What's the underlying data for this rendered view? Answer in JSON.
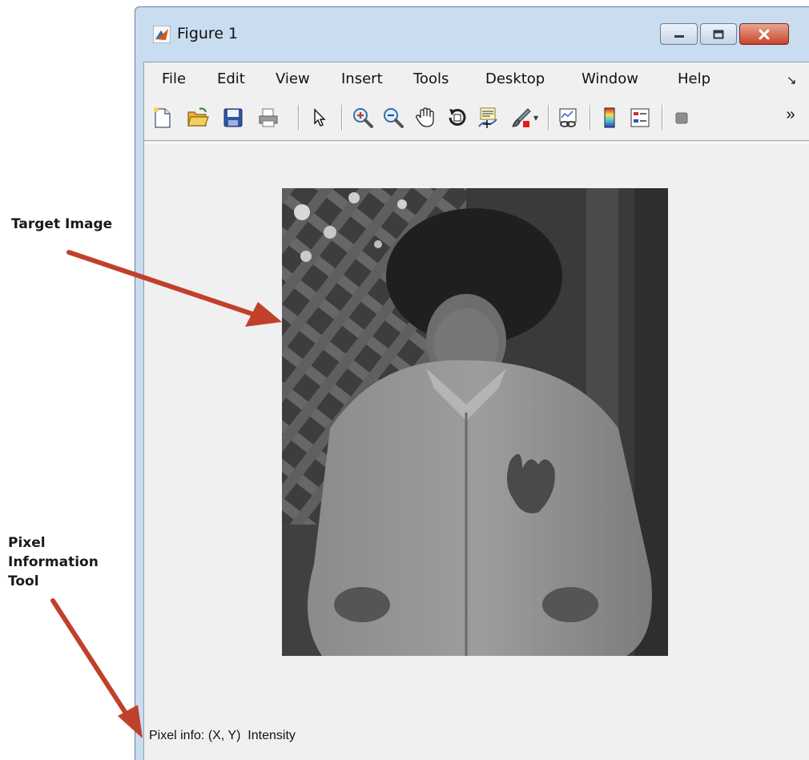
{
  "annotations": {
    "target_image_label": "Target Image",
    "pixel_tool_label_lines": [
      "Pixel",
      "Information",
      "Tool"
    ],
    "arrow_color": "#c0412b"
  },
  "window": {
    "title": "Figure 1",
    "controls": [
      "minimize-icon",
      "maximize-icon",
      "close-icon"
    ]
  },
  "menu": {
    "items": [
      "File",
      "Edit",
      "View",
      "Insert",
      "Tools",
      "Desktop",
      "Window",
      "Help"
    ],
    "dock_glyph": "↘"
  },
  "toolbar": {
    "tools": [
      "new-figure-icon",
      "open-file-icon",
      "save-icon",
      "print-icon",
      "edit-plot-icon",
      "zoom-in-icon",
      "zoom-out-icon",
      "pan-icon",
      "rotate-3d-icon",
      "data-cursor-icon",
      "brush-icon",
      "link-plot-icon",
      "colorbar-icon",
      "legend-icon",
      "hide-plot-tools-icon"
    ],
    "overflow_glyph": "»",
    "brush_dropdown_glyph": "▾"
  },
  "status": {
    "pixel_info": "Pixel info: (X, Y)  Intensity"
  }
}
